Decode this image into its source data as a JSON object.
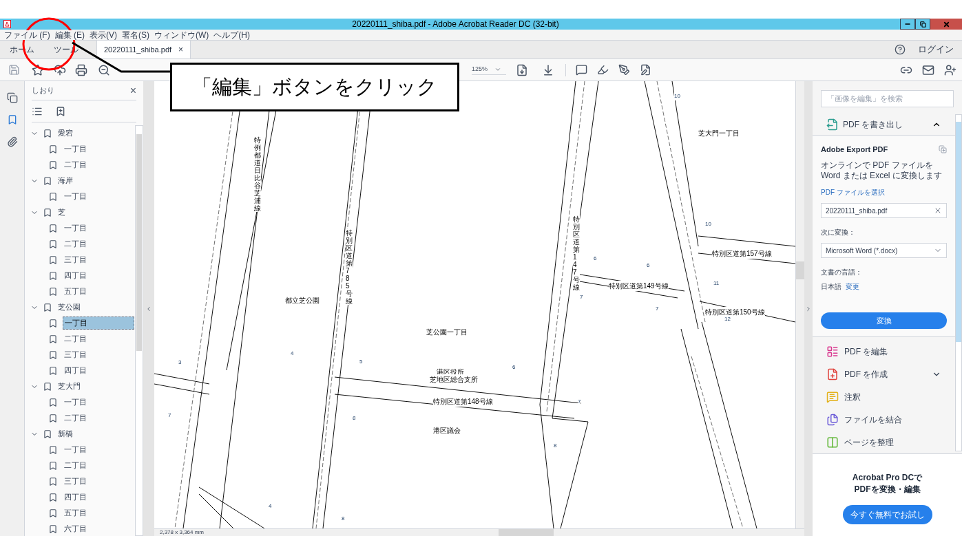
{
  "window": {
    "title": "20220111_shiba.pdf - Adobe Acrobat Reader DC (32-bit)"
  },
  "menu": [
    "ファイル (F)",
    "編集 (E)",
    "表示(V)",
    "署名(S)",
    "ウィンドウ(W)",
    "ヘルプ(H)"
  ],
  "tabs": [
    {
      "label": "ホーム",
      "selected": false,
      "kind": "nav"
    },
    {
      "label": "ツール",
      "selected": false,
      "kind": "nav"
    },
    {
      "label": "20220111_shiba.pdf",
      "selected": true,
      "kind": "document",
      "close": "×"
    }
  ],
  "login": "ログイン",
  "toolbar": {
    "zoom": "125%"
  },
  "bookmarks": {
    "title": "しおり",
    "close": "×",
    "items": [
      {
        "label": "愛宕",
        "expanded": true,
        "selected": false,
        "children": [
          {
            "label": "一丁目",
            "selected": false
          },
          {
            "label": "二丁目",
            "selected": false
          }
        ]
      },
      {
        "label": "海岸",
        "expanded": true,
        "selected": false,
        "children": [
          {
            "label": "一丁目",
            "selected": false
          }
        ]
      },
      {
        "label": "芝",
        "expanded": true,
        "selected": false,
        "children": [
          {
            "label": "一丁目",
            "selected": false
          },
          {
            "label": "二丁目",
            "selected": false
          },
          {
            "label": "三丁目",
            "selected": false
          },
          {
            "label": "四丁目",
            "selected": false
          },
          {
            "label": "五丁目",
            "selected": false
          }
        ]
      },
      {
        "label": "芝公園",
        "expanded": true,
        "selected": false,
        "children": [
          {
            "label": "一丁目",
            "selected": true
          },
          {
            "label": "二丁目",
            "selected": false
          },
          {
            "label": "三丁目",
            "selected": false
          },
          {
            "label": "四丁目",
            "selected": false
          }
        ]
      },
      {
        "label": "芝大門",
        "expanded": true,
        "selected": false,
        "children": [
          {
            "label": "一丁目",
            "selected": false
          },
          {
            "label": "二丁目",
            "selected": false
          }
        ]
      },
      {
        "label": "新橋",
        "expanded": true,
        "selected": false,
        "children": [
          {
            "label": "一丁目",
            "selected": false
          },
          {
            "label": "二丁目",
            "selected": false
          },
          {
            "label": "三丁目",
            "selected": false
          },
          {
            "label": "四丁目",
            "selected": false
          },
          {
            "label": "五丁目",
            "selected": false
          },
          {
            "label": "六丁目",
            "selected": false
          }
        ]
      }
    ]
  },
  "document": {
    "page_size": "2,378 x 3,364 mm",
    "labels": [
      {
        "text": "芝公園一丁目",
        "kind": "label"
      },
      {
        "text": "芝大門一丁目",
        "kind": "label"
      },
      {
        "text": "都立芝公園",
        "kind": "label"
      },
      {
        "text": "港区役所",
        "kind": "label"
      },
      {
        "text": "芝地区総合支所",
        "kind": "label"
      },
      {
        "text": "特別区道第148号線",
        "kind": "label"
      },
      {
        "text": "港区議会",
        "kind": "label"
      },
      {
        "text": "特別区道第149号線",
        "kind": "label"
      },
      {
        "text": "特別区道第157号線",
        "kind": "label"
      },
      {
        "text": "特別区道第150号線",
        "kind": "label"
      },
      {
        "text": "特例都道日比谷芝浦線",
        "kind": "vertical"
      },
      {
        "text": "特別区道第785号線",
        "kind": "vertical"
      },
      {
        "text": "特別区道第147号線",
        "kind": "vertical"
      },
      {
        "text": "10",
        "kind": "number"
      },
      {
        "text": "10",
        "kind": "number"
      },
      {
        "text": "6",
        "kind": "number"
      },
      {
        "text": "6",
        "kind": "number"
      },
      {
        "text": "7",
        "kind": "number"
      },
      {
        "text": "7",
        "kind": "number"
      },
      {
        "text": "11",
        "kind": "number"
      },
      {
        "text": "12",
        "kind": "number"
      },
      {
        "text": "3",
        "kind": "number"
      },
      {
        "text": "4",
        "kind": "number"
      },
      {
        "text": "5",
        "kind": "number"
      },
      {
        "text": "6",
        "kind": "number"
      },
      {
        "text": "7",
        "kind": "number"
      },
      {
        "text": "8",
        "kind": "number"
      },
      {
        "text": "8",
        "kind": "number"
      },
      {
        "text": "7",
        "kind": "number"
      },
      {
        "text": "4",
        "kind": "number"
      },
      {
        "text": "8",
        "kind": "number"
      }
    ]
  },
  "tools_panel": {
    "search": {
      "placeholder": "「画像を編集」を検索"
    },
    "export": {
      "header": "PDF を書き出し",
      "expanded": true,
      "title": "Adobe Export PDF",
      "description": "オンラインで PDF ファイルを Word または Excel に変換します",
      "select_link": "PDF ファイルを選択",
      "file": "20220111_shiba.pdf",
      "convert_label": "次に変換：",
      "format": "Microsoft Word (*.docx)",
      "language_label": "文書の言語：",
      "language": "日本語",
      "change_link": "変更",
      "button": "変換"
    },
    "tools": [
      {
        "label": "PDF を編集",
        "kind": "edit",
        "color": "#d9378f",
        "expandable": false
      },
      {
        "label": "PDF を作成",
        "kind": "create",
        "color": "#e0413b",
        "expandable": true
      },
      {
        "label": "注釈",
        "kind": "comment",
        "color": "#e3b21c",
        "expandable": false
      },
      {
        "label": "ファイルを結合",
        "kind": "combine",
        "color": "#6b5bd8",
        "expandable": false
      },
      {
        "label": "ページを整理",
        "kind": "organize",
        "color": "#5cb531",
        "expandable": false
      }
    ],
    "promo": {
      "lines": [
        "Acrobat Pro DCで",
        "PDFを変換・編集"
      ],
      "button": "今すぐ無料でお試し"
    }
  },
  "annotation": {
    "text": "「編集」ボタンをクリック"
  }
}
